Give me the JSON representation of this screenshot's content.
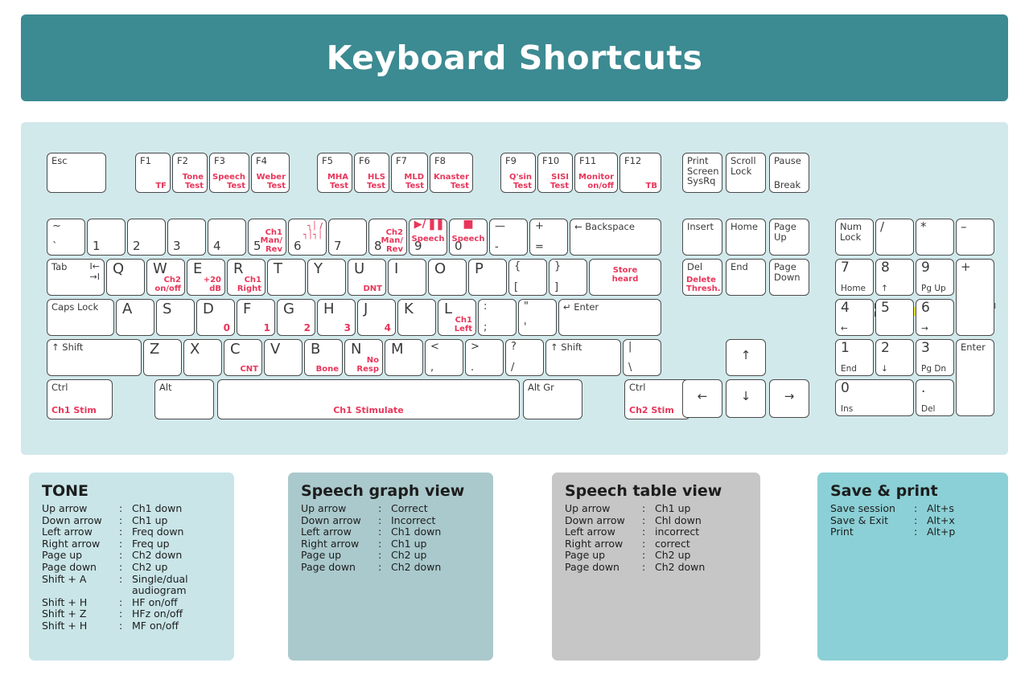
{
  "header": {
    "title": "Keyboard Shortcuts"
  },
  "indicators": [
    {
      "label": "Num Lock",
      "color": "#e3e337"
    },
    {
      "label": "Caps Lock",
      "color": "#e3e337"
    },
    {
      "label": "Scroll Lock",
      "color": "#e3e337"
    }
  ],
  "function_row": [
    {
      "name": "esc",
      "top": "Esc",
      "red": ""
    },
    {
      "name": "f1",
      "top": "F1",
      "red": "TF"
    },
    {
      "name": "f2",
      "top": "F2",
      "red": "Tone\nTest"
    },
    {
      "name": "f3",
      "top": "F3",
      "red": "Speech\nTest"
    },
    {
      "name": "f4",
      "top": "F4",
      "red": "Weber\nTest"
    },
    {
      "name": "f5",
      "top": "F5",
      "red": "MHA\nTest"
    },
    {
      "name": "f6",
      "top": "F6",
      "red": "HLS\nTest"
    },
    {
      "name": "f7",
      "top": "F7",
      "red": "MLD\nTest"
    },
    {
      "name": "f8",
      "top": "F8",
      "red": "Knaster\nTest"
    },
    {
      "name": "f9",
      "top": "F9",
      "red": "Q'sin\nTest"
    },
    {
      "name": "f10",
      "top": "F10",
      "red": "SISI\nTest"
    },
    {
      "name": "f11",
      "top": "F11",
      "red": "Monitor\non/off"
    },
    {
      "name": "f12",
      "top": "F12",
      "red": "TB"
    },
    {
      "name": "print-screen",
      "top": "Print\nScreen\nSysRq",
      "red": ""
    },
    {
      "name": "scroll-lock",
      "top": "Scroll\nLock",
      "red": ""
    },
    {
      "name": "pause-break",
      "top": "Pause",
      "bottom": "Break",
      "red": ""
    }
  ],
  "number_row": [
    {
      "name": "backtick",
      "top": "~",
      "bottom": "`"
    },
    {
      "name": "key-1",
      "num": "1"
    },
    {
      "name": "key-2",
      "num": "2"
    },
    {
      "name": "key-3",
      "num": "3"
    },
    {
      "name": "key-4",
      "num": "4"
    },
    {
      "name": "key-5",
      "num": "5",
      "red": "Ch1\nMan/\nRev"
    },
    {
      "name": "key-6",
      "num": "6",
      "red": "┐│ / ┐│┐│"
    },
    {
      "name": "key-7",
      "num": "7"
    },
    {
      "name": "key-8",
      "num": "8",
      "red": "Ch2\nMan/\nRev"
    },
    {
      "name": "key-9",
      "num": "9",
      "red": "▶/▐▐",
      "redsub": "Speech"
    },
    {
      "name": "key-0",
      "num": "0",
      "red": "■",
      "redsub": "Speech"
    },
    {
      "name": "minus",
      "top": "—",
      "bottom": "-"
    },
    {
      "name": "equals",
      "top": "+",
      "bottom": "="
    },
    {
      "name": "backspace",
      "top": "←  Backspace"
    }
  ],
  "qwerty_row": [
    {
      "name": "tab",
      "top": "Tab",
      "extra": "I←\n →I"
    },
    {
      "name": "key-q",
      "big": "Q"
    },
    {
      "name": "key-w",
      "big": "W",
      "red": "Ch2\non/off"
    },
    {
      "name": "key-e",
      "big": "E",
      "red": "+20\ndB"
    },
    {
      "name": "key-r",
      "big": "R",
      "red": "Ch1\nRight"
    },
    {
      "name": "key-t",
      "big": "T"
    },
    {
      "name": "key-y",
      "big": "Y"
    },
    {
      "name": "key-u",
      "big": "U",
      "red": "DNT"
    },
    {
      "name": "key-i",
      "big": "I"
    },
    {
      "name": "key-o",
      "big": "O"
    },
    {
      "name": "key-p",
      "big": "P"
    },
    {
      "name": "bracket-left",
      "top": "{",
      "bottom": "["
    },
    {
      "name": "bracket-right",
      "top": "}",
      "bottom": "]"
    },
    {
      "name": "backslash",
      "redcenter": "Store\nheard"
    }
  ],
  "home_row": [
    {
      "name": "caps-lock",
      "top": "Caps Lock"
    },
    {
      "name": "key-a",
      "big": "A"
    },
    {
      "name": "key-s",
      "big": "S"
    },
    {
      "name": "key-d",
      "big": "D",
      "red": "0"
    },
    {
      "name": "key-f",
      "big": "F",
      "red": "1"
    },
    {
      "name": "key-g",
      "big": "G",
      "red": "2"
    },
    {
      "name": "key-h",
      "big": "H",
      "red": "3"
    },
    {
      "name": "key-j",
      "big": "J",
      "red": "4"
    },
    {
      "name": "key-k",
      "big": "K"
    },
    {
      "name": "key-l",
      "big": "L",
      "red": "Ch1\nLeft"
    },
    {
      "name": "semicolon",
      "top": ":",
      "bottom": ";"
    },
    {
      "name": "quote",
      "top": "\"",
      "bottom": "'"
    },
    {
      "name": "enter",
      "top": "↵ Enter"
    }
  ],
  "shift_row": [
    {
      "name": "shift-left",
      "top": "↑ Shift"
    },
    {
      "name": "key-z",
      "big": "Z"
    },
    {
      "name": "key-x",
      "big": "X"
    },
    {
      "name": "key-c",
      "big": "C",
      "red": "CNT"
    },
    {
      "name": "key-v",
      "big": "V"
    },
    {
      "name": "key-b",
      "big": "B",
      "red": "Bone"
    },
    {
      "name": "key-n",
      "big": "N",
      "red": "No\nResp"
    },
    {
      "name": "key-m",
      "big": "M"
    },
    {
      "name": "comma",
      "top": "<",
      "bottom": ","
    },
    {
      "name": "period",
      "top": ">",
      "bottom": "."
    },
    {
      "name": "slash",
      "top": "?",
      "bottom": "/"
    },
    {
      "name": "shift-right",
      "top": "↑ Shift"
    },
    {
      "name": "pipe",
      "top": "|",
      "bottom": "\\"
    }
  ],
  "bottom_row": [
    {
      "name": "ctrl-left",
      "top": "Ctrl",
      "red": "Ch1 Stim"
    },
    {
      "name": "alt-left",
      "top": "Alt"
    },
    {
      "name": "space",
      "red": "Ch1    Stimulate"
    },
    {
      "name": "alt-gr",
      "top": "Alt Gr"
    },
    {
      "name": "ctrl-right",
      "top": "Ctrl",
      "red": "Ch2 Stim"
    }
  ],
  "nav_cluster": [
    {
      "name": "insert",
      "top": "Insert"
    },
    {
      "name": "home",
      "top": "Home"
    },
    {
      "name": "page-up",
      "top": "Page\nUp"
    },
    {
      "name": "delete",
      "top": "Del",
      "red": "Delete\nThresh."
    },
    {
      "name": "end",
      "top": "End"
    },
    {
      "name": "page-down",
      "top": "Page\nDown"
    }
  ],
  "arrow_cluster": [
    {
      "name": "arrow-up",
      "glyph": "↑"
    },
    {
      "name": "arrow-left",
      "glyph": "←"
    },
    {
      "name": "arrow-down",
      "glyph": "↓"
    },
    {
      "name": "arrow-right",
      "glyph": "→"
    }
  ],
  "numpad": [
    {
      "name": "num-lock",
      "top": "Num\nLock"
    },
    {
      "name": "numpad-divide",
      "top": "/"
    },
    {
      "name": "numpad-multiply",
      "top": "*"
    },
    {
      "name": "numpad-minus",
      "top": "–"
    },
    {
      "name": "numpad-7",
      "num": "7",
      "sub": "Home"
    },
    {
      "name": "numpad-8",
      "num": "8",
      "sub": "↑"
    },
    {
      "name": "numpad-9",
      "num": "9",
      "sub": "Pg Up"
    },
    {
      "name": "numpad-plus",
      "top": "+"
    },
    {
      "name": "numpad-4",
      "num": "4",
      "sub": "←"
    },
    {
      "name": "numpad-5",
      "num": "5"
    },
    {
      "name": "numpad-6",
      "num": "6",
      "sub": "→"
    },
    {
      "name": "numpad-1",
      "num": "1",
      "sub": "End"
    },
    {
      "name": "numpad-2",
      "num": "2",
      "sub": "↓"
    },
    {
      "name": "numpad-3",
      "num": "3",
      "sub": "Pg Dn"
    },
    {
      "name": "numpad-enter",
      "top": "Enter"
    },
    {
      "name": "numpad-0",
      "num": "0",
      "sub": "Ins"
    },
    {
      "name": "numpad-decimal",
      "num": ".",
      "sub": "Del"
    }
  ],
  "legends": {
    "tone": {
      "title": "TONE",
      "rows": [
        {
          "key": "Up arrow",
          "sep": ":",
          "value": "Ch1 down"
        },
        {
          "key": "Down arrow",
          "sep": ":",
          "value": "Ch1 up"
        },
        {
          "key": "Left arrow",
          "sep": ":",
          "value": "Freq down"
        },
        {
          "key": "Right arrow",
          "sep": ":",
          "value": "Freq up"
        },
        {
          "key": "Page up",
          "sep": ":",
          "value": "Ch2 down"
        },
        {
          "key": "Page down",
          "sep": ":",
          "value": "Ch2 up"
        },
        {
          "key": "Shift + A",
          "sep": ":",
          "value": "Single/dual\naudiogram"
        },
        {
          "key": "Shift + H",
          "sep": ":",
          "value": "HF on/off"
        },
        {
          "key": "Shift + Z",
          "sep": ":",
          "value": "HFz on/off"
        },
        {
          "key": "Shift + H",
          "sep": ":",
          "value": "MF on/off"
        }
      ]
    },
    "speech_graph": {
      "title": "Speech graph view",
      "rows": [
        {
          "key": "Up arrow",
          "sep": ":",
          "value": "Correct"
        },
        {
          "key": "Down arrow",
          "sep": ":",
          "value": "Incorrect"
        },
        {
          "key": "Left arrow",
          "sep": ":",
          "value": "Ch1 down"
        },
        {
          "key": "Right arrow",
          "sep": ":",
          "value": "Ch1 up"
        },
        {
          "key": "Page up",
          "sep": ":",
          "value": "Ch2 up"
        },
        {
          "key": "Page down",
          "sep": ":",
          "value": "Ch2 down"
        }
      ]
    },
    "speech_table": {
      "title": "Speech table view",
      "rows": [
        {
          "key": "Up arrow",
          "sep": ":",
          "value": "Ch1 up"
        },
        {
          "key": "Down arrow",
          "sep": ":",
          "value": "Chl down"
        },
        {
          "key": "Left arrow",
          "sep": ":",
          "value": "incorrect"
        },
        {
          "key": "Right arrow",
          "sep": ":",
          "value": "correct"
        },
        {
          "key": "Page up",
          "sep": ":",
          "value": "Ch2 up"
        },
        {
          "key": "Page down",
          "sep": ":",
          "value": "Ch2 down"
        }
      ]
    },
    "save_print": {
      "title": "Save & print",
      "rows": [
        {
          "key": "Save session",
          "sep": ":",
          "value": "Alt+s"
        },
        {
          "key": "Save & Exit",
          "sep": ":",
          "value": "Alt+x"
        },
        {
          "key": "Print",
          "sep": ":",
          "value": "Alt+p"
        }
      ]
    }
  }
}
